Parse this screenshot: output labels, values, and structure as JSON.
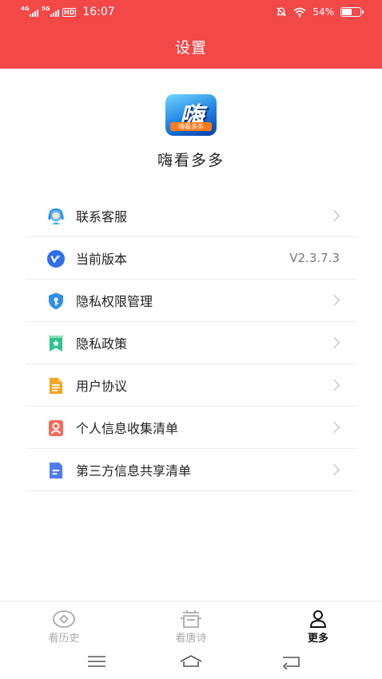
{
  "status_bar": {
    "sim1": "4G",
    "sim2": "5G",
    "hd": "HD",
    "time": "16:07",
    "battery": "54%",
    "battery_level": 0.54
  },
  "header": {
    "title": "设置"
  },
  "app": {
    "logo_text": "嗨",
    "logo_band": "嗨看多多",
    "name": "嗨看多多"
  },
  "menu": [
    {
      "label": "联系客服",
      "right": "",
      "icon": "customer-service-icon",
      "color": "#2fa3f0"
    },
    {
      "label": "当前版本",
      "right": "V2.3.7.3",
      "icon": "version-icon",
      "color": "#2f6fe8"
    },
    {
      "label": "隐私权限管理",
      "right": "",
      "icon": "shield-icon",
      "color": "#2f8ee8"
    },
    {
      "label": "隐私政策",
      "right": "",
      "icon": "bookmark-star-icon",
      "color": "#2fc28a"
    },
    {
      "label": "用户协议",
      "right": "",
      "icon": "document-icon",
      "color": "#f5a623"
    },
    {
      "label": "个人信息收集清单",
      "right": "",
      "icon": "person-card-icon",
      "color": "#f26b5b"
    },
    {
      "label": "第三方信息共享清单",
      "right": "",
      "icon": "list-doc-icon",
      "color": "#4f7cf0"
    }
  ],
  "tabs": [
    {
      "label": "看历史",
      "icon": "eye-icon",
      "active": false
    },
    {
      "label": "看唐诗",
      "icon": "pot-icon",
      "active": false
    },
    {
      "label": "更多",
      "icon": "person-icon",
      "active": true
    }
  ],
  "nav": {
    "menu": "menu-icon",
    "home": "home-icon",
    "back": "back-icon"
  }
}
